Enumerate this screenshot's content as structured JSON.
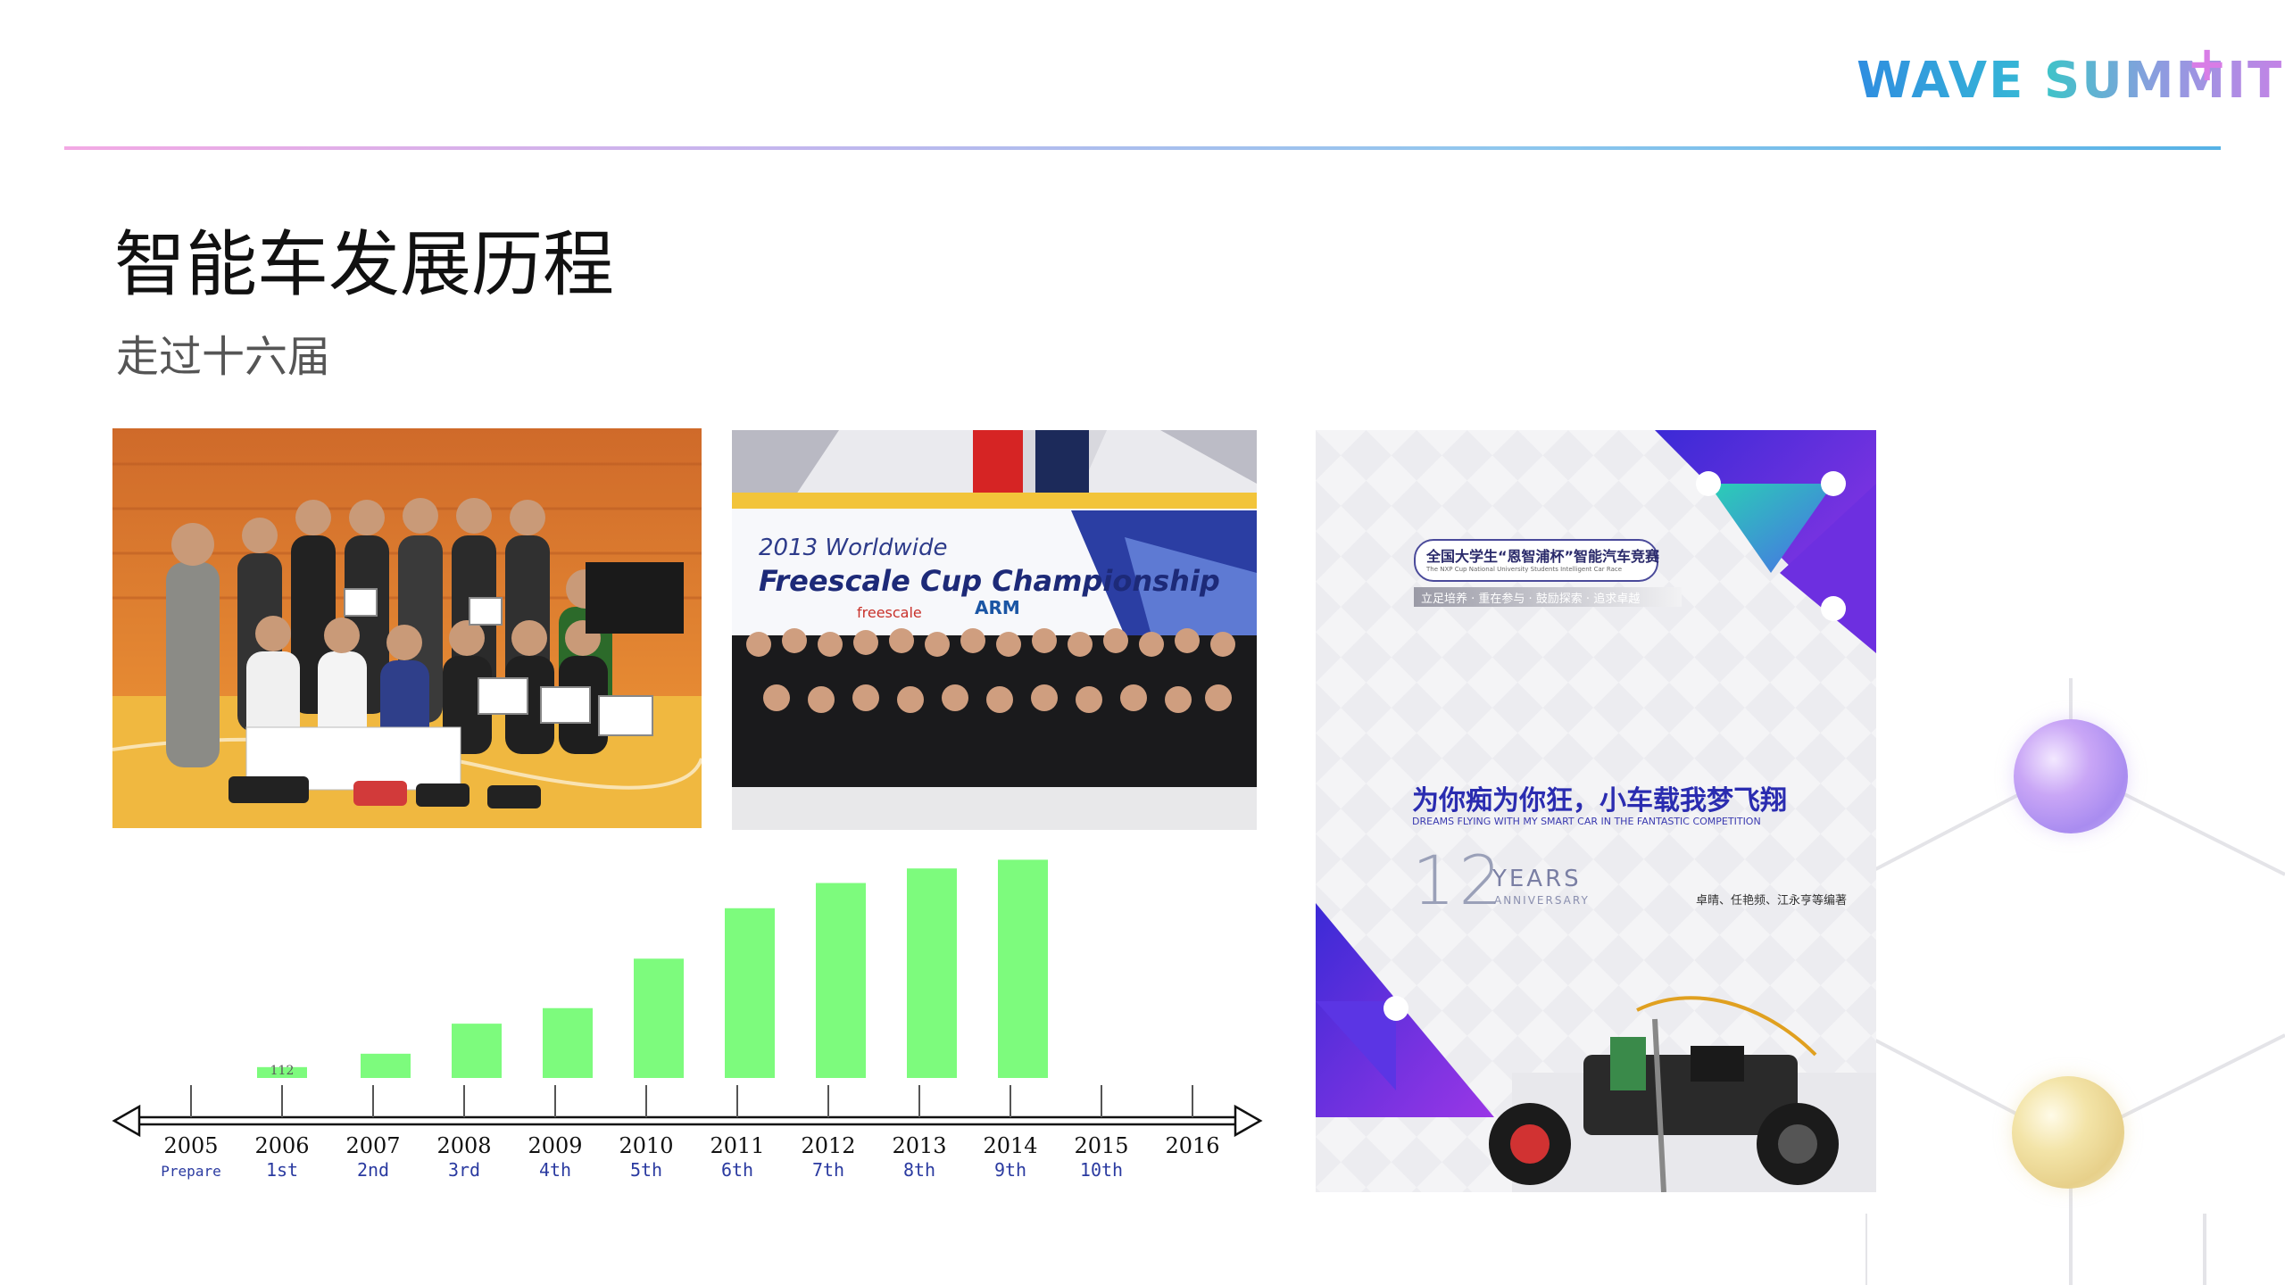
{
  "logo": {
    "part1": "WAVE",
    "part2": "SUMMIT",
    "plus": "+"
  },
  "slide": {
    "title": "智能车发展历程",
    "subtitle": "走过十六届"
  },
  "photo2": {
    "banner_line1": "2013 Worldwide",
    "banner_line2": "Freescale Cup Championship",
    "sponsor1": "freescale",
    "sponsor2": "ARM"
  },
  "poster": {
    "competition_name": "全国大学生“恩智浦杯”智能汽车竞赛",
    "competition_en": "The NXP Cup National University Students Intelligent Car Race",
    "motto": "立足培养 · 重在参与 · 鼓励探索 · 追求卓越",
    "headline": "为你痴为你狂，小车载我梦飞翔",
    "headline_en": "DREAMS FLYING WITH MY SMART CAR IN THE FANTASTIC COMPETITION",
    "years_number": "12",
    "years_word": "YEARS",
    "anniversary": "ANNIVERSARY",
    "authors": "卓晴、任艳频、江永亨等编著"
  },
  "chart_data": {
    "type": "bar",
    "categories": [
      "2005",
      "2006",
      "2007",
      "2008",
      "2009",
      "2010",
      "2011",
      "2012",
      "2013",
      "2014",
      "2015",
      "2016"
    ],
    "editions": [
      "Prepare",
      "1st",
      "2nd",
      "3rd",
      "4th",
      "5th",
      "6th",
      "7th",
      "8th",
      "9th",
      "10th",
      ""
    ],
    "values": [
      0,
      112,
      250,
      560,
      720,
      1230,
      1750,
      2010,
      2160,
      2250,
      0,
      0
    ],
    "data_labels": [
      "",
      "112",
      "",
      "",
      "",
      "",
      "",
      "",
      "",
      "",
      "",
      ""
    ],
    "ylim": [
      0,
      2300
    ],
    "title": "",
    "xlabel": "",
    "ylabel": "",
    "bar_color": "#7dfb7d",
    "grid": false
  }
}
